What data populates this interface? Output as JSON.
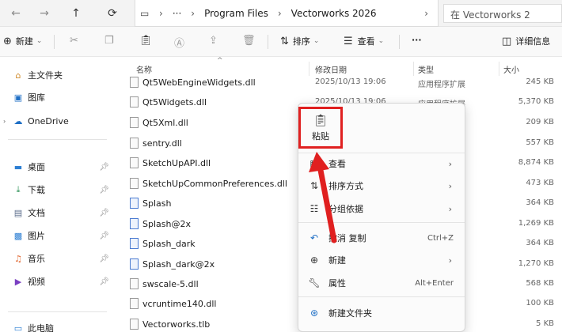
{
  "address": {
    "back_icon": "arrow-left-icon",
    "forward_icon": "arrow-right-icon",
    "up_icon": "arrow-up-icon",
    "refresh_icon": "refresh-icon",
    "crumbs": [
      "Program Files",
      "Vectorworks 2026"
    ],
    "more": "···",
    "search_placeholder": "在 Vectorworks 2"
  },
  "toolbar": {
    "new_label": "新建",
    "sort_label": "排序",
    "view_label": "查看",
    "more_label": "···",
    "details_label": "详细信息"
  },
  "sidebar": {
    "items": [
      {
        "label": "主文件夹",
        "icon": "home-icon"
      },
      {
        "label": "图库",
        "icon": "gallery-icon"
      },
      {
        "label": "OneDrive",
        "icon": "cloud-icon"
      },
      {
        "label": "桌面",
        "icon": "desktop-icon"
      },
      {
        "label": "下载",
        "icon": "download-icon"
      },
      {
        "label": "文档",
        "icon": "document-icon"
      },
      {
        "label": "图片",
        "icon": "pictures-icon"
      },
      {
        "label": "音乐",
        "icon": "music-icon"
      },
      {
        "label": "视频",
        "icon": "video-icon"
      },
      {
        "label": "此电脑",
        "icon": "computer-icon"
      }
    ]
  },
  "columns": {
    "name": "名称",
    "date": "修改日期",
    "type": "类型",
    "size": "大小"
  },
  "files": [
    {
      "name": "Qt5WebEngineWidgets.dll",
      "date": "2025/10/13 19:06",
      "type": "应用程序扩展",
      "size": "245 KB"
    },
    {
      "name": "Qt5Widgets.dll",
      "date": "2025/10/13 19:06",
      "type": "应用程序扩展",
      "size": "5,370 KB"
    },
    {
      "name": "Qt5Xml.dll",
      "date": "",
      "type": "",
      "size": "209 KB"
    },
    {
      "name": "sentry.dll",
      "date": "",
      "type": "",
      "size": "557 KB"
    },
    {
      "name": "SketchUpAPI.dll",
      "date": "",
      "type": "",
      "size": "8,874 KB"
    },
    {
      "name": "SketchUpCommonPreferences.dll",
      "date": "",
      "type": "",
      "size": "473 KB"
    },
    {
      "name": "Splash",
      "date": "",
      "type": "",
      "size": "364 KB"
    },
    {
      "name": "Splash@2x",
      "date": "",
      "type": "",
      "size": "1,269 KB"
    },
    {
      "name": "Splash_dark",
      "date": "",
      "type": "",
      "size": "364 KB"
    },
    {
      "name": "Splash_dark@2x",
      "date": "",
      "type": "",
      "size": "1,270 KB"
    },
    {
      "name": "swscale-5.dll",
      "date": "",
      "type": "",
      "size": "568 KB"
    },
    {
      "name": "vcruntime140.dll",
      "date": "",
      "type": "",
      "size": "100 KB"
    },
    {
      "name": "Vectorworks.tlb",
      "date": "",
      "type": "",
      "size": "5 KB"
    }
  ],
  "context_menu": {
    "paste_label": "粘贴",
    "items": [
      {
        "label": "查看",
        "icon": "grid-view-icon"
      },
      {
        "label": "排序方式",
        "icon": "sort-icon"
      },
      {
        "label": "分组依据",
        "icon": "group-icon"
      },
      {
        "label": "撤消 复制",
        "icon": "undo-icon",
        "shortcut": "Ctrl+Z"
      },
      {
        "label": "新建",
        "icon": "plus-circle-icon"
      },
      {
        "label": "属性",
        "icon": "wrench-icon",
        "shortcut": "Alt+Enter"
      },
      {
        "label": "新建文件夹",
        "icon": "new-folder-icon"
      }
    ]
  },
  "colors": {
    "highlight": "#e02020",
    "accent": "#0067c0"
  }
}
